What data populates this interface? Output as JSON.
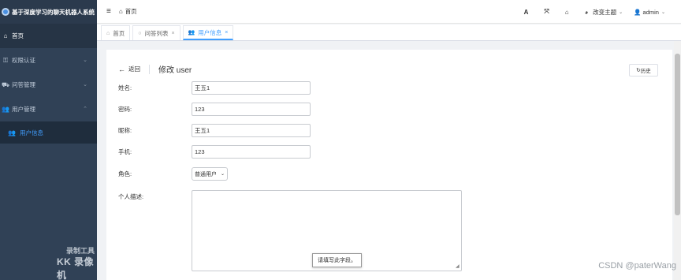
{
  "app": {
    "title": "基于深度学习的聊天机器人系统"
  },
  "sidebar": {
    "items": [
      {
        "label": "首页",
        "icon": "home-icon"
      },
      {
        "label": "权限认证",
        "icon": "user-key-icon"
      },
      {
        "label": "问答管理",
        "icon": "car-icon"
      },
      {
        "label": "用户管理",
        "icon": "users-icon"
      }
    ],
    "sub_items": [
      {
        "label": "用户信息",
        "icon": "users-icon"
      }
    ]
  },
  "header": {
    "breadcrumb": "首页",
    "theme_label": "改变主题",
    "user_label": "admin"
  },
  "tabs": [
    {
      "label": "首页"
    },
    {
      "label": "问答列表"
    },
    {
      "label": "用户信息"
    }
  ],
  "page": {
    "back_label": "返回",
    "title": "修改 user",
    "history_label": "历史"
  },
  "form": {
    "name_label": "姓名:",
    "name_value": "王五1",
    "password_label": "密码:",
    "password_value": "123",
    "nickname_label": "昵称:",
    "nickname_value": "王五1",
    "phone_label": "手机:",
    "phone_value": "123",
    "role_label": "角色:",
    "role_value": "普通用户",
    "desc_label": "个人描述:",
    "desc_value": "",
    "tooltip": "请填写此字段。"
  },
  "watermark": {
    "recorder": "录制工具",
    "kk": "KK 录像机",
    "csdn": "CSDN @paterWang"
  }
}
